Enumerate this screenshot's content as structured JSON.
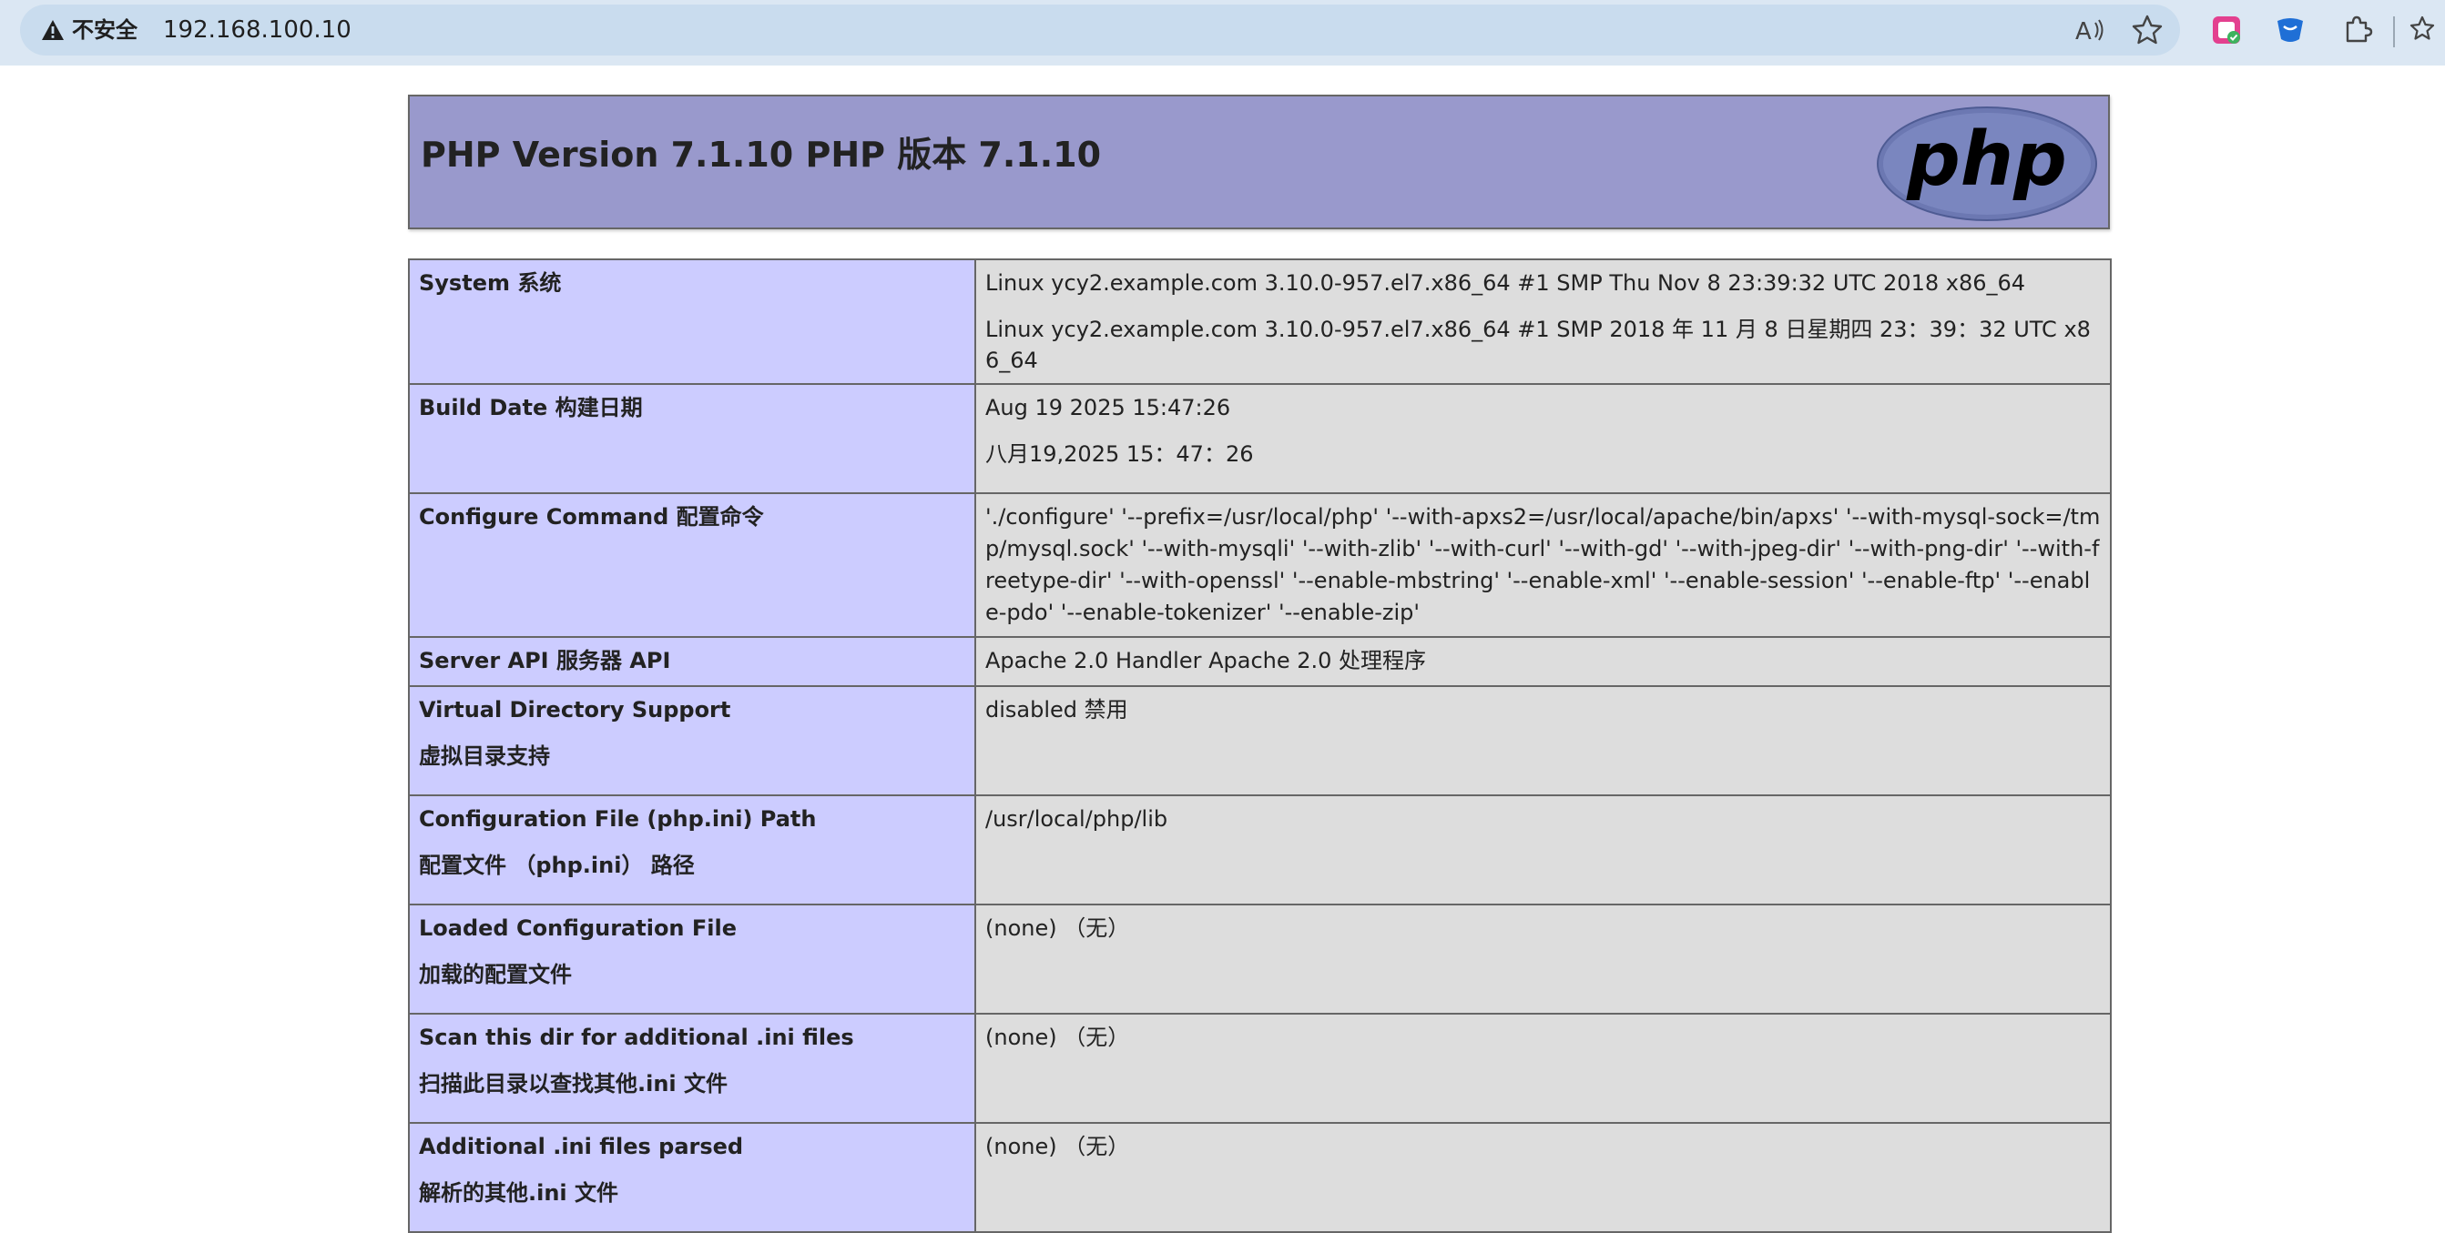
{
  "browser": {
    "security_label": "不安全",
    "url": "192.168.100.10",
    "icons": [
      "warning-icon",
      "read-aloud-icon",
      "favorite-star-icon",
      "extension-icon",
      "extension-icon",
      "puzzle-extensions-icon",
      "favorites-list-icon"
    ]
  },
  "header": {
    "title": "PHP Version 7.1.10  PHP 版本 7.1.10",
    "logo_text": "php"
  },
  "rows": [
    {
      "key": [
        "System   系统"
      ],
      "value": [
        "Linux ycy2.example.com 3.10.0-957.el7.x86_64 #1 SMP Thu Nov 8 23:39:32 UTC 2018 x86_64",
        "Linux ycy2.example.com 3.10.0-957.el7.x86_64 #1 SMP 2018 年 11 月 8 日星期四 23：39：32 UTC x86_64"
      ]
    },
    {
      "key": [
        "Build Date   构建日期"
      ],
      "value": [
        "Aug 19 2025 15:47:26",
        "八月19,2025 15：47：26"
      ]
    },
    {
      "key": [
        "Configure Command   配置命令"
      ],
      "value": [
        "'./configure' '--prefix=/usr/local/php' '--with-apxs2=/usr/local/apache/bin/apxs' '--with-mysql-sock=/tmp/mysql.sock' '--with-mysqli' '--with-zlib' '--with-curl' '--with-gd' '--with-jpeg-dir' '--with-png-dir' '--with-freetype-dir' '--with-openssl' '--enable-mbstring' '--enable-xml' '--enable-session' '--enable-ftp' '--enable-pdo' '--enable-tokenizer' '--enable-zip'"
      ]
    },
    {
      "key": [
        "Server API   服务器 API"
      ],
      "value": [
        "Apache 2.0 Handler   Apache 2.0 处理程序"
      ]
    },
    {
      "key": [
        "Virtual Directory Support",
        "虚拟目录支持"
      ],
      "value": [
        "disabled   禁用"
      ]
    },
    {
      "key": [
        "Configuration File (php.ini) Path",
        "配置文件 （php.ini） 路径"
      ],
      "value": [
        "/usr/local/php/lib"
      ]
    },
    {
      "key": [
        "Loaded Configuration File",
        "加载的配置文件"
      ],
      "value": [
        "(none)   （无）"
      ]
    },
    {
      "key": [
        "Scan this dir for additional .ini files",
        "扫描此目录以查找其他.ini 文件"
      ],
      "value": [
        "(none)   （无）"
      ]
    },
    {
      "key": [
        "Additional .ini files parsed",
        "解析的其他.ini 文件"
      ],
      "value": [
        "(none)   （无）"
      ]
    }
  ]
}
